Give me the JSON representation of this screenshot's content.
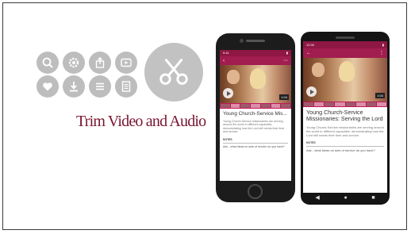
{
  "headline": "Trim Video and Audio",
  "colors": {
    "accent": "#a21d4f",
    "headline": "#7a1530",
    "icon_bg": "#bdbdbd"
  },
  "feature_icons": [
    "search-icon",
    "gear-icon",
    "share-icon",
    "play-video-icon",
    "heart-icon",
    "download-icon",
    "list-icon",
    "document-icon"
  ],
  "main_icon": "scissors-icon",
  "iphone": {
    "status_time": "9:41",
    "video_duration": "1:04",
    "video_title": "Young Church-Service Mis...",
    "description": "Young Church-Service missionaries are serving around the world in different capacities, demonstrating how the Lord still needs their time and service.",
    "notes_label": "NOTES",
    "note_text": "Ask - what ideas on acts of service do you have?"
  },
  "android": {
    "status_time": "12:30",
    "video_duration": "1:04",
    "video_title": "Young Church-Service Missionaries: Serving the Lord",
    "description": "Young Church-Service missionaries are serving around the world in different capacities, demonstrating how the Lord still needs their time and service.",
    "notes_label": "NOTES",
    "note_text": "Ask - what ideas on acts of service do you have?"
  }
}
